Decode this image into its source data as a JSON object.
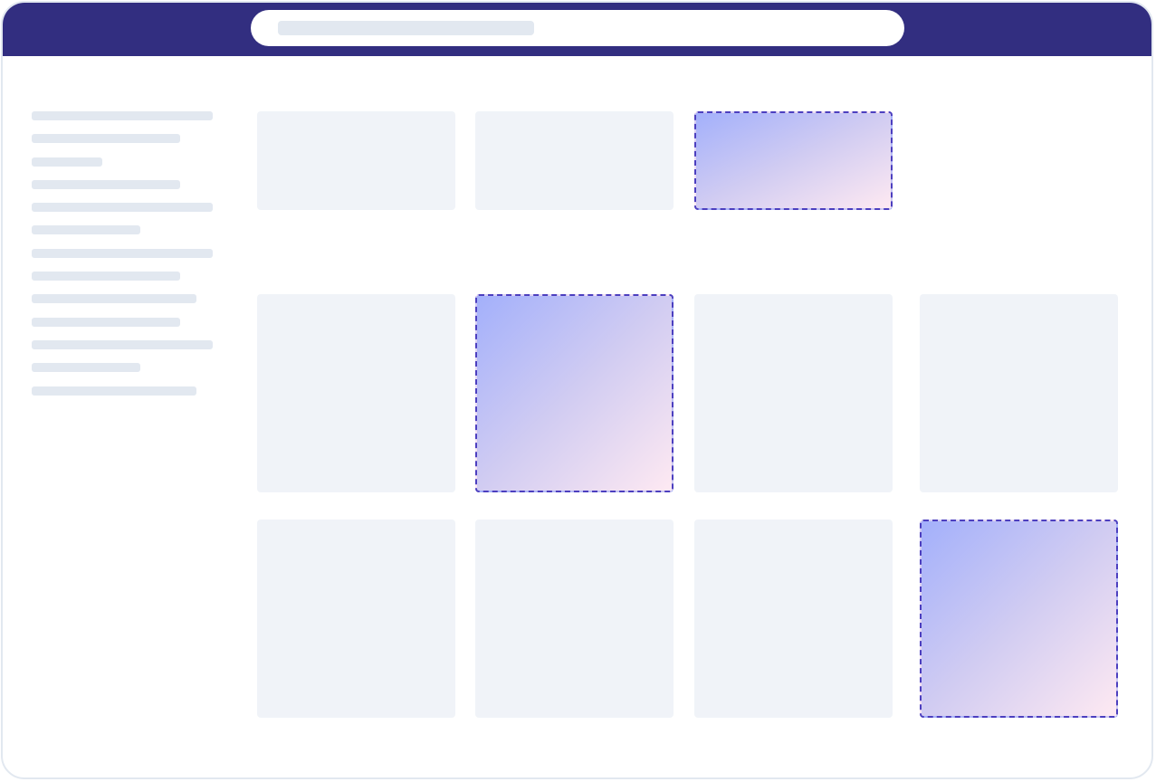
{
  "header": {
    "search_placeholder": ""
  },
  "sidebar": {
    "line_fill_fractions": [
      1.0,
      0.82,
      0.39,
      0.82,
      1.0,
      0.6,
      1.0,
      0.82,
      0.91,
      0.82,
      1.0,
      0.6,
      0.91
    ]
  },
  "grid": {
    "rows": [
      {
        "cells": [
          "card",
          "card",
          "dropzone"
        ]
      },
      {
        "cells": [
          "card",
          "dropzone",
          "card",
          "card"
        ]
      },
      {
        "cells": [
          "card",
          "card",
          "card",
          "dropzone"
        ]
      }
    ]
  },
  "colors": {
    "topbar": "#322e80",
    "skeleton": "#e2e8f0",
    "card": "#f0f3f8",
    "dropzone_border": "#4c3fbf",
    "dropzone_gradient_start": "#a3b0fb",
    "dropzone_gradient_end": "#fee9f2"
  }
}
